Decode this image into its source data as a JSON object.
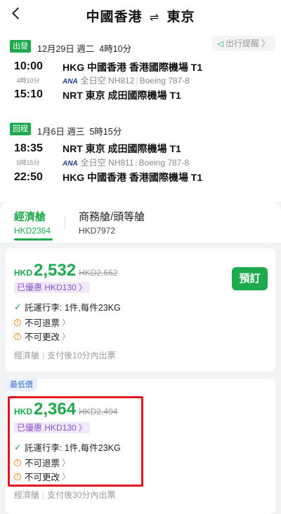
{
  "header": {
    "title_from": "中國香港",
    "title_arrow": "⇌",
    "title_to": "東京"
  },
  "outbound": {
    "tag": "出發",
    "date": "12月29日 週二",
    "duration_total": "4時10分",
    "reminder": "出行提醒",
    "dep_time": "10:00",
    "flight_dur": "4時10分",
    "arr_time": "15:10",
    "dep_airport": "HKG 中國香港 香港國際機場 T1",
    "airline": "全日空",
    "flight_no": "NH812",
    "aircraft": "Boeing 787-8",
    "arr_airport": "NRT 東京 成田國際機場 T1"
  },
  "inbound": {
    "tag": "回程",
    "date": "1月6日 週三",
    "duration_total": "5時15分",
    "dep_time": "18:35",
    "flight_dur": "5時15分",
    "arr_time": "22:50",
    "dep_airport": "NRT 東京 成田國際機場 T1",
    "airline": "全日空",
    "flight_no": "NH811",
    "aircraft": "Boeing 787-8",
    "arr_airport": "HKG 中國香港 香港國際機場 T1"
  },
  "cabins": [
    {
      "name": "經濟艙",
      "price": "HKD2364"
    },
    {
      "name": "商務艙/頭等艙",
      "price": "HKD7972"
    }
  ],
  "fares": [
    {
      "currency": "HKD",
      "price": "2,532",
      "old_price": "HKD2,662",
      "promo": "已優惠 HKD130",
      "baggage": "託運行李: 1件,每件23KG",
      "refund": "不可退票",
      "change": "不可更改",
      "cabin": "經濟艙",
      "ticketing": "支付後10分內出票",
      "book": "預訂"
    },
    {
      "badge": "最低價",
      "currency": "HKD",
      "price": "2,364",
      "old_price": "HKD2,494",
      "promo": "已優惠 HKD130",
      "baggage": "託運行李: 1件,每件23KG",
      "refund": "不可退票",
      "change": "不可更改",
      "cabin": "經濟艙",
      "ticketing": "支付後30分內出票"
    }
  ],
  "colors": {
    "brand": "#1daa4c",
    "promo": "#8a55c6",
    "warn": "#f08a1a",
    "highlight": "#e3131b"
  }
}
